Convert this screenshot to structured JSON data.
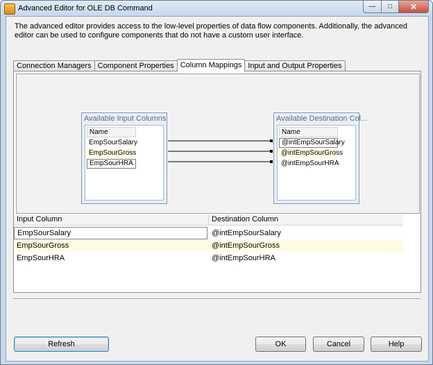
{
  "window": {
    "title": "Advanced Editor for OLE DB Command",
    "controls": {
      "minimize": "—",
      "maximize": "□",
      "close": "✕"
    }
  },
  "description": "The advanced editor provides access to the low-level properties of data flow components. Additionally, the advanced editor can be used to configure components that do not have a custom user interface.",
  "tabs": [
    {
      "label": "Connection Managers",
      "active": false
    },
    {
      "label": "Component Properties",
      "active": false
    },
    {
      "label": "Column Mappings",
      "active": true
    },
    {
      "label": "Input and Output Properties",
      "active": false
    }
  ],
  "input_columns": {
    "title": "Available Input Columns",
    "header": "Name",
    "items": [
      "EmpSourSalary",
      "EmpSourGross",
      "EmpSourHRA"
    ]
  },
  "destination_columns": {
    "title": "Available Destination Col...",
    "header": "Name",
    "items": [
      "@intEmpSourSalary",
      "@intEmpSourGross",
      "@intEmpSourHRA"
    ]
  },
  "mappings": {
    "headers": {
      "input": "Input Column",
      "destination": "Destination Column"
    },
    "rows": [
      {
        "input": "EmpSourSalary",
        "destination": "@intEmpSourSalary"
      },
      {
        "input": "EmpSourGross",
        "destination": "@intEmpSourGross"
      },
      {
        "input": "EmpSourHRA",
        "destination": "@intEmpSourHRA"
      }
    ]
  },
  "buttons": {
    "refresh": "Refresh",
    "ok": "OK",
    "cancel": "Cancel",
    "help": "Help"
  },
  "colors": {
    "alt_row": "#fffce3",
    "title_bar": "#c9daec",
    "close_button": "#c45139"
  }
}
